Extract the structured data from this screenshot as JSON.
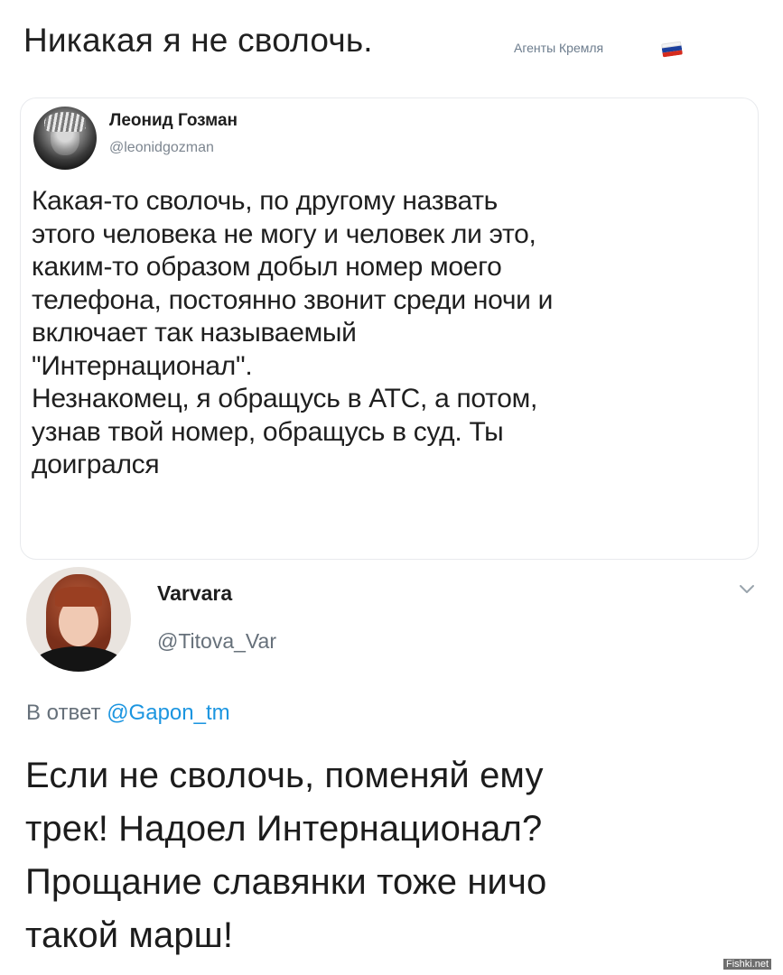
{
  "header": {
    "title": "Никакая я не сволочь.",
    "tag": "Агенты Кремля"
  },
  "quote_tweet": {
    "author_name": "Леонид Гозман",
    "author_handle": "@leonidgozman",
    "text": "Какая-то сволочь, по другому назвать\nэтого человека не могу и человек ли это,\nкаким-то образом добыл номер моего\nтелефона, постоянно звонит среди ночи и\nвключает так называемый\n\"Интернационал\".\nНезнакомец, я обращусь в АТС, а потом,\nузнав твой номер, обращусь в суд. Ты\nдоигрался"
  },
  "reply_tweet": {
    "author_name": "Varvara",
    "author_handle": "@Titova_Var",
    "reply_prefix": "В ответ",
    "reply_mention": "@Gapon_tm",
    "text": "Если не сволочь, поменяй ему\nтрек! Надоел Интернационал?\nПрощание славянки тоже ничо\nтакой марш!"
  },
  "watermark": "Fishki.net",
  "colors": {
    "flag_white": "#ffffff",
    "flag_blue": "#1c3f9c",
    "flag_red": "#d52b1e",
    "mention_blue": "#1b95e0"
  }
}
